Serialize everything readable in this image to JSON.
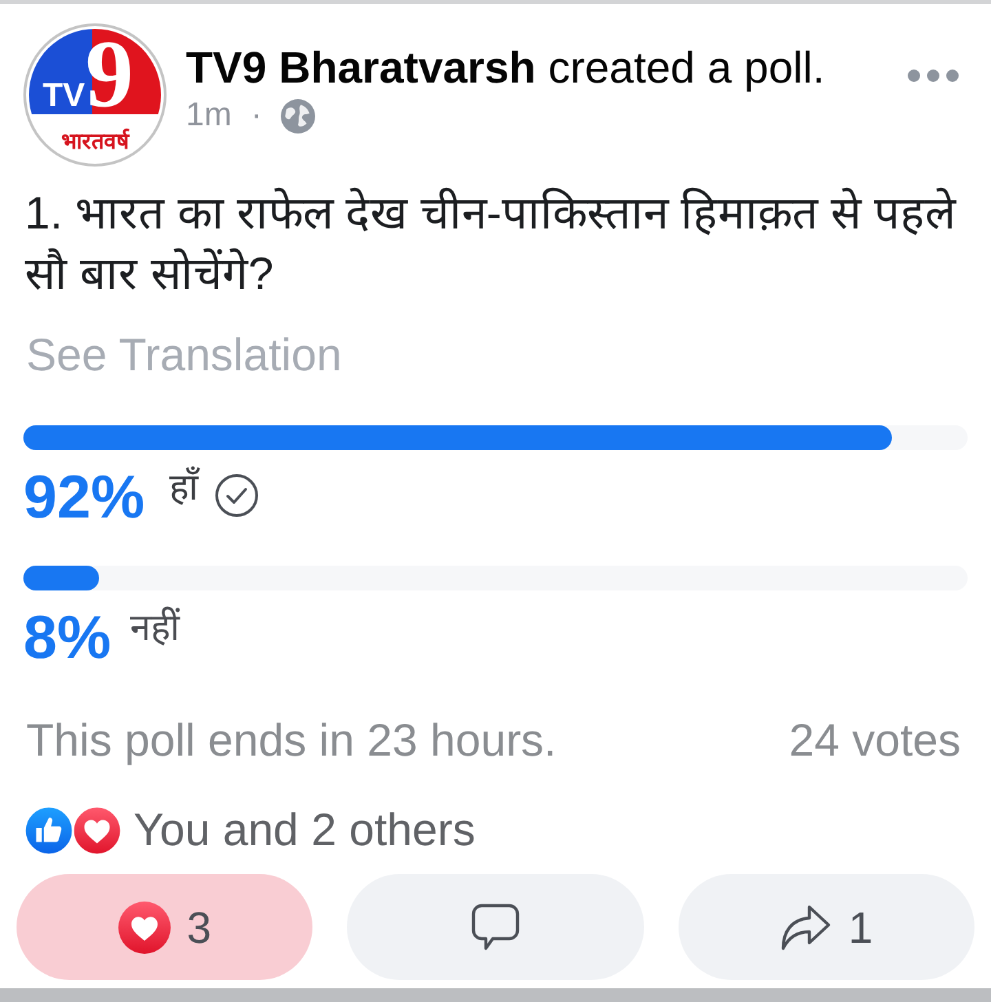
{
  "post": {
    "logo": {
      "letters": "TV",
      "number": "9",
      "tagline": "भारतवर्ष"
    },
    "author": "TV9 Bharatvarsh",
    "action": "created a poll.",
    "time": "1m",
    "separator": "·"
  },
  "question": "1. भारत का राफेल देख चीन-पाकिस्तान हिमाक़त से पहले सौ बार सोचेंगे?",
  "see_translation": "See Translation",
  "poll": {
    "options": [
      {
        "percent": "92%",
        "label": "हाँ",
        "level": 0.92,
        "selected": true
      },
      {
        "percent": "8%",
        "label": "नहीं",
        "level": 0.08,
        "selected": false
      }
    ],
    "ends": "This poll ends in 23 hours.",
    "votes": "24 votes"
  },
  "reactions": {
    "text": "You and 2 others"
  },
  "actions": [
    {
      "kind": "react",
      "count": "3",
      "active": true
    },
    {
      "kind": "comment",
      "active": false
    },
    {
      "kind": "share",
      "count": "1",
      "active": false
    }
  ]
}
